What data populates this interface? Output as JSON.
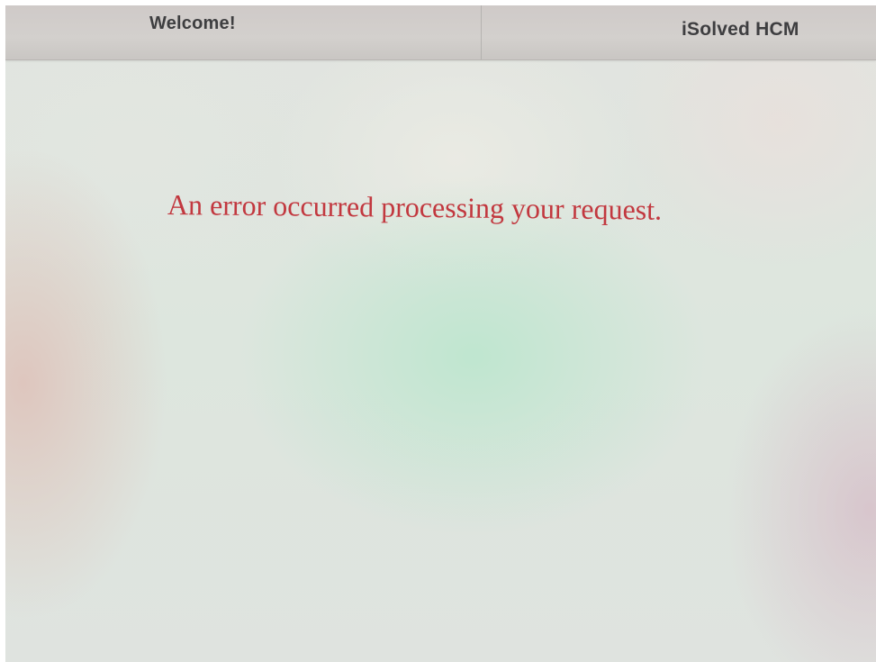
{
  "header": {
    "welcome_label": "Welcome!",
    "brand_label": "iSolved HCM"
  },
  "main": {
    "error_message": "An error occurred processing your request."
  },
  "colors": {
    "error_text": "#c2383f",
    "header_text": "#3e3e40",
    "header_background": "#cfcac8"
  }
}
